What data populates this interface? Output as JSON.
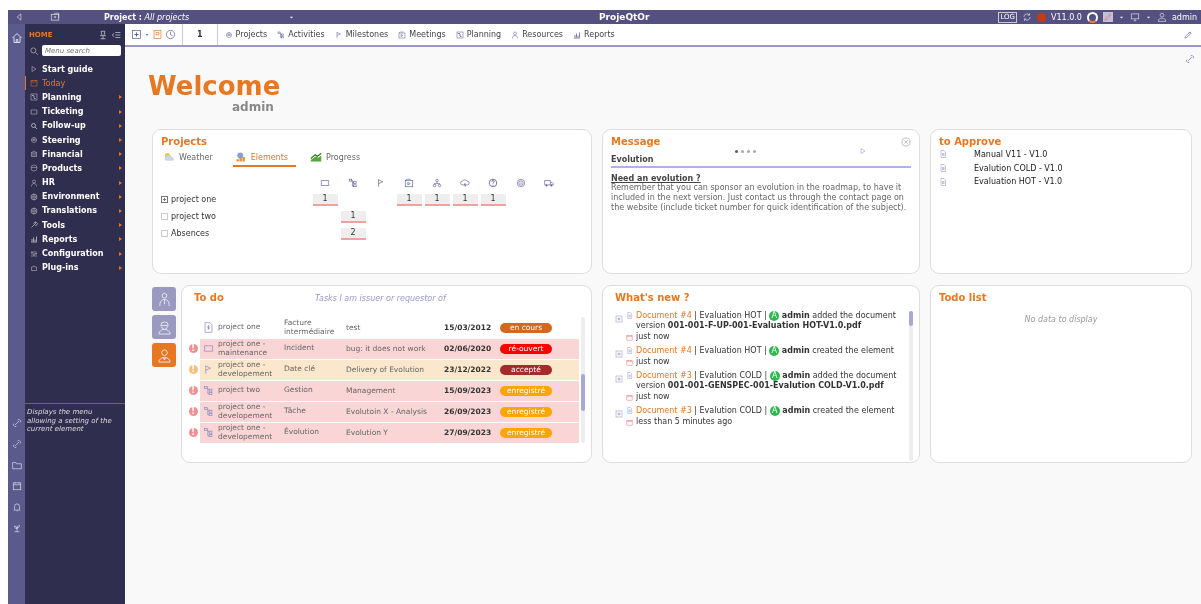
{
  "top_bar": {
    "project_label": "Project :",
    "project_value": "All projects",
    "app_title": "ProjeQtOr",
    "log_label": "LOG",
    "version": "V11.0.0",
    "user": "admin"
  },
  "sidebar": {
    "home_label": "HOME",
    "search_placeholder": "Menu search",
    "items": [
      {
        "label": "Start guide",
        "selected": false,
        "submenu": false
      },
      {
        "label": "Today",
        "selected": true,
        "submenu": false
      },
      {
        "label": "Planning",
        "selected": false,
        "submenu": true
      },
      {
        "label": "Ticketing",
        "selected": false,
        "submenu": true
      },
      {
        "label": "Follow-up",
        "selected": false,
        "submenu": true
      },
      {
        "label": "Steering",
        "selected": false,
        "submenu": true
      },
      {
        "label": "Financial",
        "selected": false,
        "submenu": true
      },
      {
        "label": "Products",
        "selected": false,
        "submenu": true
      },
      {
        "label": "HR",
        "selected": false,
        "submenu": true
      },
      {
        "label": "Environment",
        "selected": false,
        "submenu": true
      },
      {
        "label": "Translations",
        "selected": false,
        "submenu": true
      },
      {
        "label": "Tools",
        "selected": false,
        "submenu": true
      },
      {
        "label": "Reports",
        "selected": false,
        "submenu": true
      },
      {
        "label": "Configuration",
        "selected": false,
        "submenu": true
      },
      {
        "label": "Plug-ins",
        "selected": false,
        "submenu": true
      }
    ],
    "hint": "Displays the menu allowing a setting of the current element"
  },
  "toolbar": {
    "count": "1",
    "links": [
      "Projects",
      "Activities",
      "Milestones",
      "Meetings",
      "Planning",
      "Resources",
      "Reports"
    ]
  },
  "welcome": {
    "title": "Welcome",
    "user": "admin"
  },
  "projects": {
    "title": "Projects",
    "tabs": [
      {
        "label": "Weather",
        "selected": false
      },
      {
        "label": "Elements",
        "selected": true
      },
      {
        "label": "Progress",
        "selected": false
      }
    ],
    "rows": [
      {
        "name": "project one",
        "expandable": true,
        "cells": [
          "1",
          null,
          null,
          "1",
          "1",
          "1",
          "1",
          null,
          null
        ]
      },
      {
        "name": "project two",
        "expandable": false,
        "cells": [
          null,
          "1",
          null,
          null,
          null,
          null,
          null,
          null,
          null
        ]
      },
      {
        "name": "Absences",
        "expandable": false,
        "cells": [
          null,
          "2",
          null,
          null,
          null,
          null,
          null,
          null,
          null
        ]
      }
    ]
  },
  "message": {
    "title": "Message",
    "dots": [
      {
        "selected": true
      },
      {
        "selected": false
      },
      {
        "selected": false
      },
      {
        "selected": false
      }
    ],
    "subject": "Evolution",
    "heading": "Need an evolution ?",
    "text": "Remember that you can sponsor an evolution in the roadmap, to have it included in the next version. Just contact us through the contact page on the website (include ticket number for quick identification of the subject)."
  },
  "to_approve": {
    "title": "to Approve",
    "items": [
      "Manual V11 - V1.0",
      "Evalution COLD - V1.0",
      "Evaluation HOT - V1.0"
    ]
  },
  "todo": {
    "title": "To do",
    "subtitle": "Tasks I am issuer or requestor of",
    "view_buttons": [
      {
        "kind": "manager",
        "selected": false
      },
      {
        "kind": "worker",
        "selected": false
      },
      {
        "kind": "requestor",
        "selected": true
      }
    ],
    "rows": [
      {
        "kind": "invoice",
        "project": "project one",
        "type": "Facture intermédiaire",
        "name": "test",
        "date": "15/03/2012",
        "status": "en cours",
        "color": "#d2691e"
      },
      {
        "kind": "ticket",
        "alert": {
          "text": "!",
          "color": "#f09090"
        },
        "project": "project one - maintenance",
        "type": "Incident",
        "name": "bug: it does not work",
        "date": "02/06/2020",
        "status": "ré-ouvert",
        "color": "#ff0000"
      },
      {
        "kind": "milestone",
        "alert": {
          "text": "!",
          "color": "#f5c07a"
        },
        "project": "project one - developement",
        "type": "Date clé",
        "name": "Delivery of Evolution",
        "date": "23/12/2022",
        "status": "accepté",
        "color": "#a52a2a"
      },
      {
        "kind": "activity",
        "alert": {
          "text": "!",
          "color": "#f09090"
        },
        "project": "project two",
        "type": "Gestion",
        "name": "Management",
        "date": "15/09/2023",
        "status": "enregistré",
        "color": "#ffa500"
      },
      {
        "kind": "activity",
        "alert": {
          "text": "!",
          "color": "#f09090"
        },
        "project": "project one - developement",
        "type": "Tâche",
        "name": "Evolutoin X - Analysis",
        "date": "26/09/2023",
        "status": "enregistré",
        "color": "#ffa500"
      },
      {
        "kind": "activity",
        "alert": {
          "text": "!",
          "color": "#f09090"
        },
        "project": "project one - developement",
        "type": "Évolution",
        "name": "Evolution Y",
        "date": "27/09/2023",
        "status": "enregistré",
        "color": "#ffa500"
      }
    ]
  },
  "whats_new": {
    "title": "What's new ?",
    "items": [
      {
        "link": "Document #4",
        "object": "| Evaluation HOT |",
        "avatar": "A",
        "action": "**admin** added the document version **001-001-F-UP-001-Evaluation HOT-V1.0.pdf**",
        "time": "just now"
      },
      {
        "link": "Document #4",
        "object": "| Evaluation HOT |",
        "avatar": "A",
        "action": "**admin** created the element",
        "time": "just now"
      },
      {
        "link": "Document #3",
        "object": "| Evalution COLD |",
        "avatar": "A",
        "action": "**admin** added the document version **001-001-GENSPEC-001-Evalution COLD-V1.0.pdf**",
        "time": "just now"
      },
      {
        "link": "Document #3",
        "object": "| Evalution COLD |",
        "avatar": "A",
        "action": "**admin** created the element",
        "time": "less than 5 minutes ago"
      }
    ]
  },
  "todo_list": {
    "title": "Todo list",
    "empty": "No data to display"
  }
}
